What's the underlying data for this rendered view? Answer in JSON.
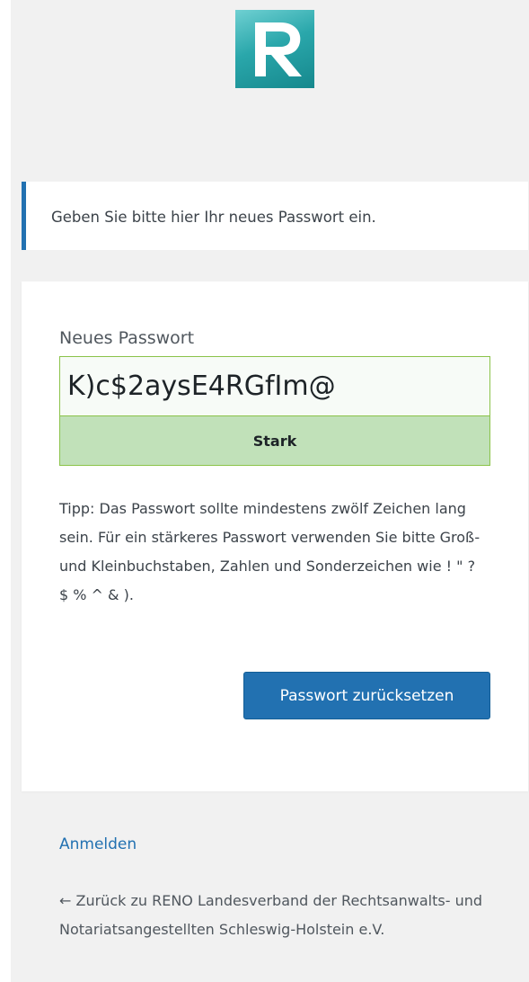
{
  "logo": {
    "icon": "site-logo-r",
    "colors": [
      "#6fd0d2",
      "#16888d"
    ]
  },
  "notice": {
    "message": "Geben Sie bitte hier Ihr neues Passwort ein."
  },
  "form": {
    "password_label": "Neues Passwort",
    "password_value": "K)c$2aysE4RGfIm@",
    "strength_label": "Stark",
    "hint": "Tipp: Das Passwort sollte mindestens zwölf Zeichen lang sein. Für ein stärkeres Passwort verwenden Sie bitte Groß- und Kleinbuchstaben, Zahlen und Sonderzeichen wie ! \" ? $ % ^ & ).",
    "submit_label": "Passwort zurücksetzen"
  },
  "nav": {
    "login_label": "Anmelden",
    "back_label": "← Zurück zu RENO Landesverband der Rechtsanwalts- und Notariatsangestellten Schleswig-Holstein e.V."
  },
  "colors": {
    "accent": "#2271b1",
    "strong": "#c1e1b9",
    "strong_border": "#8bc34a"
  }
}
